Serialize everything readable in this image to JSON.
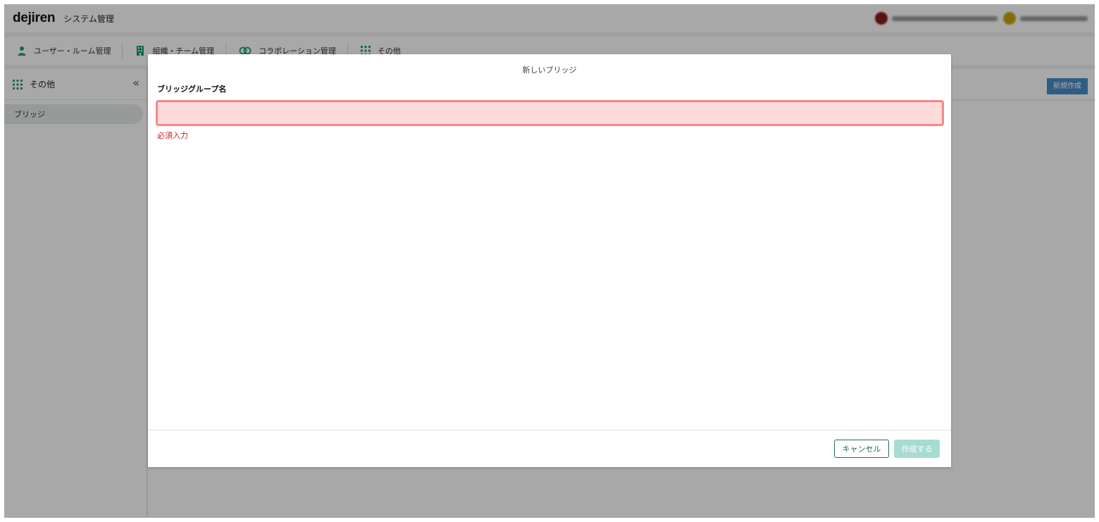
{
  "header": {
    "logo": "dejiren",
    "app_title": "システム管理",
    "users": [
      {
        "avatar_color": "#8b1a1a",
        "name_width": 160
      },
      {
        "avatar_color": "#c8a414",
        "name_width": 90
      }
    ]
  },
  "nav": {
    "items": [
      {
        "label": "ユーザー・ルーム管理",
        "icon": "person-icon"
      },
      {
        "label": "組織・チーム管理",
        "icon": "building-icon"
      },
      {
        "label": "コラボレーション管理",
        "icon": "link-icon"
      },
      {
        "label": "その他",
        "icon": "grid-icon"
      }
    ]
  },
  "sidebar": {
    "title": "その他",
    "collapse_glyph": "«",
    "items": [
      {
        "label": "ブリッジ",
        "active": true
      }
    ]
  },
  "main": {
    "new_button": "新規作成"
  },
  "modal": {
    "title": "新しいブリッジ",
    "field_label": "ブリッジグループ名",
    "field_value": "",
    "field_placeholder": "",
    "error": "必須入力",
    "cancel_label": "キャンセル",
    "create_label": "作成する"
  },
  "colors": {
    "accent": "#1d9e6e",
    "error": "#d01919",
    "input_error_bg": "#ffdada",
    "input_error_border": "#f08a8a",
    "create_disabled": "#a6ddd0",
    "new_button": "#4a8ec7"
  }
}
